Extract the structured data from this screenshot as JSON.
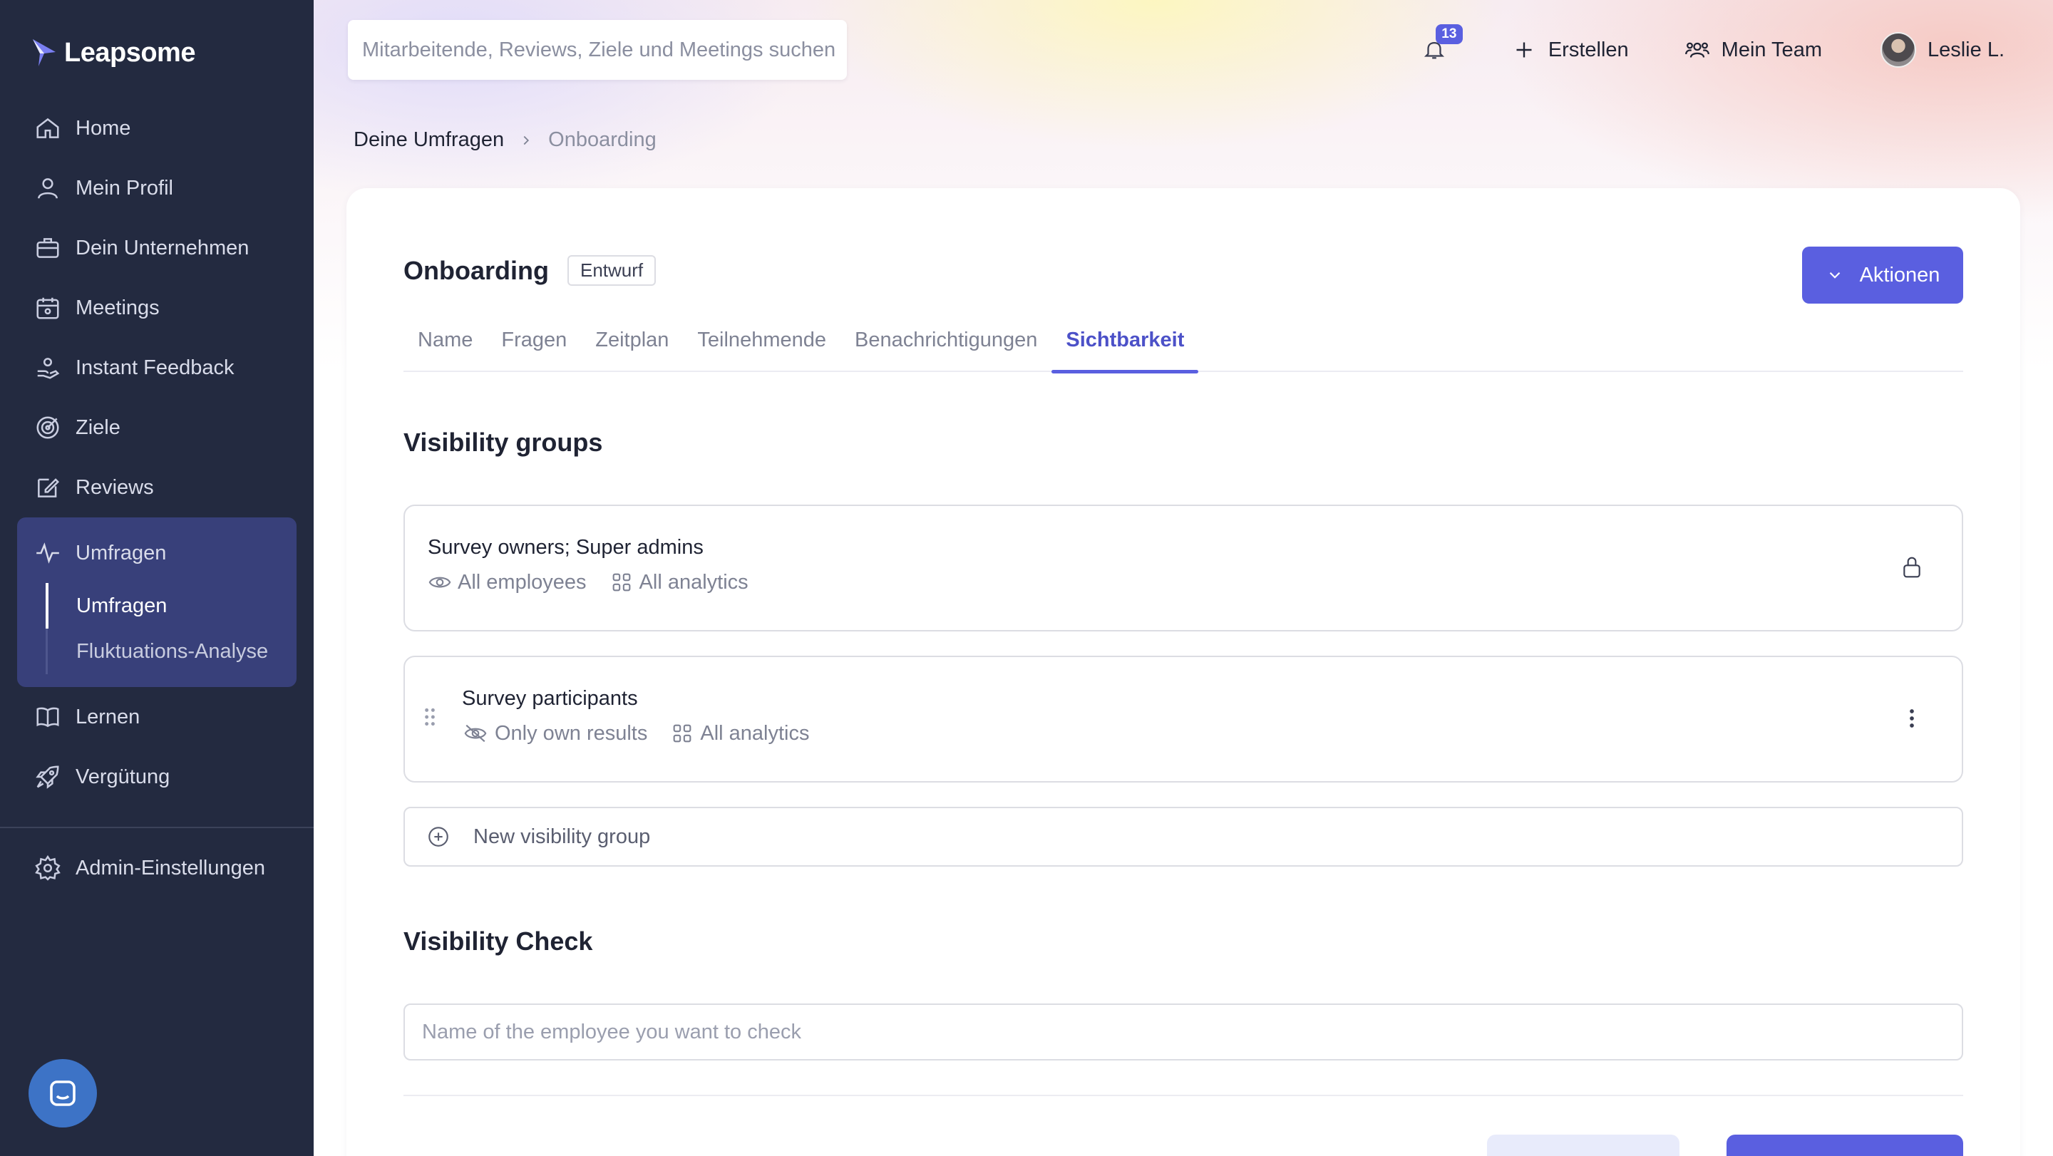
{
  "app": {
    "brand": "Leapsome"
  },
  "sidebar": {
    "items": [
      {
        "label": "Home",
        "icon": "home-icon"
      },
      {
        "label": "Mein Profil",
        "icon": "user-icon"
      },
      {
        "label": "Dein Unternehmen",
        "icon": "briefcase-icon"
      },
      {
        "label": "Meetings",
        "icon": "calendar-icon"
      },
      {
        "label": "Instant Feedback",
        "icon": "feedback-hand-icon"
      },
      {
        "label": "Ziele",
        "icon": "target-icon"
      },
      {
        "label": "Reviews",
        "icon": "edit-icon"
      }
    ],
    "surveys": {
      "label": "Umfragen",
      "icon": "pulse-icon",
      "children": [
        {
          "label": "Umfragen",
          "active": true
        },
        {
          "label": "Fluktuations-Analyse",
          "active": false
        }
      ]
    },
    "items_after": [
      {
        "label": "Lernen",
        "icon": "book-icon"
      },
      {
        "label": "Vergütung",
        "icon": "rocket-icon"
      }
    ],
    "admin": {
      "label": "Admin-Einstellungen",
      "icon": "gear-icon"
    }
  },
  "topbar": {
    "search_placeholder": "Mitarbeitende, Reviews, Ziele und Meetings suchen",
    "notifications_count": "13",
    "create_label": "Erstellen",
    "team_label": "Mein Team",
    "user_name": "Leslie L."
  },
  "breadcrumb": {
    "parent": "Deine Umfragen",
    "current": "Onboarding"
  },
  "page": {
    "title": "Onboarding",
    "status": "Entwurf",
    "actions_label": "Aktionen",
    "tabs": [
      {
        "label": "Name"
      },
      {
        "label": "Fragen"
      },
      {
        "label": "Zeitplan"
      },
      {
        "label": "Teilnehmende"
      },
      {
        "label": "Benachrichtigungen"
      },
      {
        "label": "Sichtbarkeit",
        "active": true
      }
    ]
  },
  "visibility": {
    "title": "Visibility groups",
    "groups": [
      {
        "name": "Survey owners; Super admins",
        "scope": "All employees",
        "analytics": "All analytics",
        "locked": true
      },
      {
        "name": "Survey participants",
        "scope": "Only own results",
        "analytics": "All analytics",
        "locked": false
      }
    ],
    "new_group_label": "New visibility group"
  },
  "check": {
    "title": "Visibility Check",
    "placeholder": "Name of the employee you want to check"
  },
  "colors": {
    "accent": "#5a5fe0",
    "sidebar_bg": "#232a40",
    "sidebar_active_bg": "#38407a"
  }
}
